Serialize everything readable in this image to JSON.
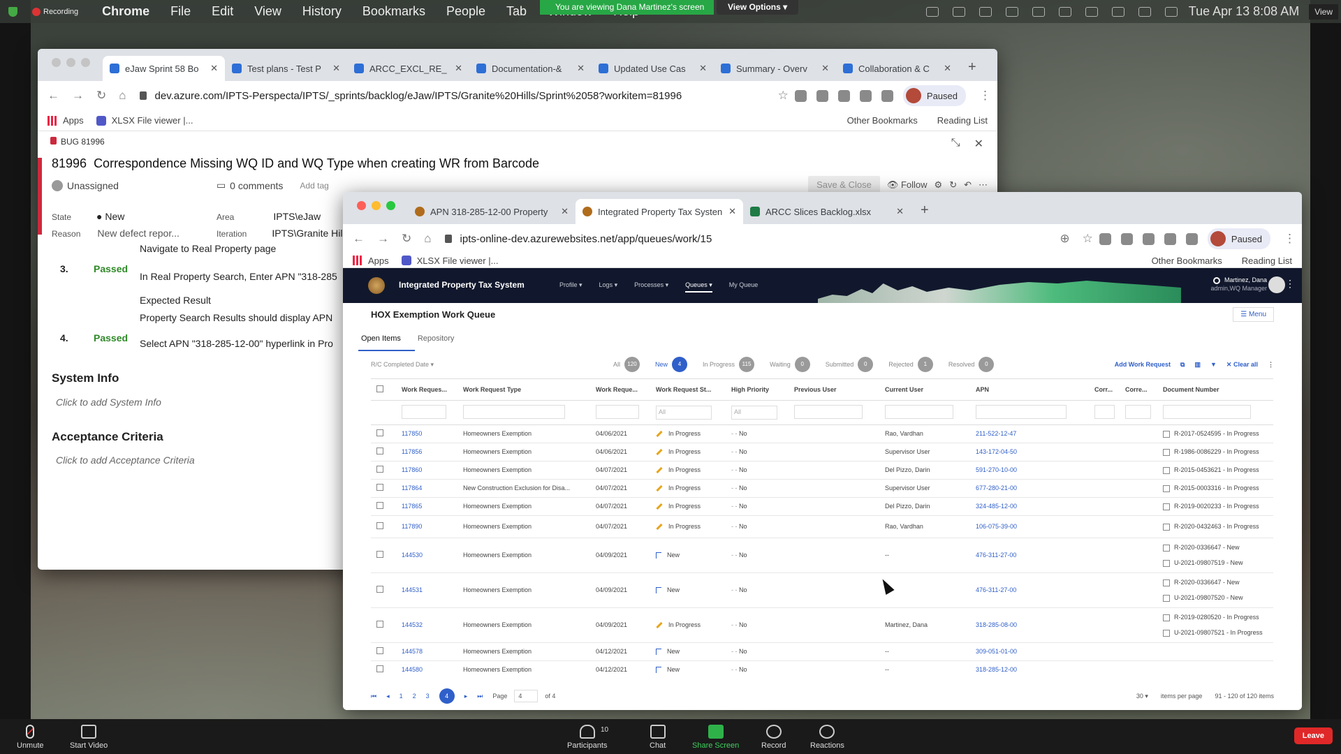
{
  "menubar": {
    "recording": "Recording",
    "items": [
      "Chrome",
      "File",
      "Edit",
      "View",
      "History",
      "Bookmarks",
      "People",
      "Tab",
      "Window",
      "Help"
    ],
    "share_banner": "You are viewing Dana Martinez's screen",
    "view_options": "View Options",
    "clock": "Tue Apr 13  8:08 AM",
    "view": "View"
  },
  "window1": {
    "tabs": [
      "eJaw Sprint 58 Bo",
      "Test plans - Test P",
      "ARCC_EXCL_RE_",
      "Documentation-&",
      "Updated Use Cas",
      "Summary - Overv",
      "Collaboration & C"
    ],
    "url": "dev.azure.com/IPTS-Perspecta/IPTS/_sprints/backlog/eJaw/IPTS/Granite%20Hills/Sprint%2058?workitem=81996",
    "bookmarks": {
      "apps": "Apps",
      "xlsx": "XLSX File viewer |...",
      "other": "Other Bookmarks",
      "reading": "Reading List"
    },
    "paused": "Paused",
    "bug_label": "BUG 81996",
    "bug_id": "81996",
    "bug_title": "Correspondence Missing WQ ID and WQ Type when creating WR from Barcode",
    "assigned": "Unassigned",
    "comments": "0 comments",
    "add_tag": "Add tag",
    "save_close": "Save & Close",
    "follow": "Follow",
    "state_label": "State",
    "state": "New",
    "reason_label": "Reason",
    "reason": "New defect repor...",
    "area_label": "Area",
    "area": "IPTS\\eJaw",
    "iteration_label": "Iteration",
    "iteration": "IPTS\\Granite Hills",
    "step_nav": "Navigate to Real Property page",
    "step3_num": "3.",
    "step3_status": "Passed",
    "step3_text": "In Real Property Search, Enter APN \"318-285",
    "expected": "Expected Result",
    "expected_text": "Property Search Results should display APN",
    "step4_num": "4.",
    "step4_status": "Passed",
    "step4_text": "Select APN \"318-285-12-00\" hyperlink in Pro",
    "system_info": "System Info",
    "system_info_ph": "Click to add System Info",
    "acceptance": "Acceptance Criteria",
    "acceptance_ph": "Click to add Acceptance Criteria"
  },
  "window2": {
    "tabs": [
      "APN 318-285-12-00 Property",
      "Integrated Property Tax Systen",
      "ARCC Slices Backlog.xlsx"
    ],
    "url": "ipts-online-dev.azurewebsites.net/app/queues/work/15",
    "paused": "Paused",
    "bookmarks": {
      "apps": "Apps",
      "xlsx": "XLSX File viewer |...",
      "other": "Other Bookmarks",
      "reading": "Reading List"
    },
    "app_name": "Integrated Property Tax System",
    "app_menu": [
      "Profile",
      "Logs",
      "Processes",
      "Queues",
      "My Queue"
    ],
    "user_name": "Martinez, Dana",
    "user_role": "admin,WQ Manager",
    "queue_title": "HOX Exemption Work Queue",
    "menu": "Menu",
    "subtabs": [
      "Open Items",
      "Repository"
    ],
    "filter_label": "R/C Completed Date",
    "chips": [
      {
        "label": "All",
        "count": "120"
      },
      {
        "label": "New",
        "count": "4"
      },
      {
        "label": "In Progress",
        "count": "115"
      },
      {
        "label": "Waiting",
        "count": "0"
      },
      {
        "label": "Submitted",
        "count": "0"
      },
      {
        "label": "Rejected",
        "count": "1"
      },
      {
        "label": "Resolved",
        "count": "0"
      }
    ],
    "add_work_request": "Add Work Request",
    "clear_all": "Clear all",
    "columns": [
      "Work Reques...",
      "Work Request Type",
      "Work Reque...",
      "Work Request St...",
      "High Priority",
      "Previous User",
      "Current User",
      "APN",
      "Corr...",
      "Corre...",
      "Document Number"
    ],
    "filter_all": "All",
    "rows": [
      {
        "id": "117850",
        "type": "Homeowners Exemption",
        "date": "04/06/2021",
        "status": "In Progress",
        "icon": "pencil",
        "hp": "No",
        "prev": "",
        "cur": "Rao, Vardhan",
        "apn": "211-522-12-47",
        "docs": [
          "R-2017-0524595 - In Progress"
        ]
      },
      {
        "id": "117856",
        "type": "Homeowners Exemption",
        "date": "04/06/2021",
        "status": "In Progress",
        "icon": "pencil",
        "hp": "No",
        "prev": "",
        "cur": "Supervisor User",
        "apn": "143-172-04-50",
        "docs": [
          "R-1986-0086229 - In Progress"
        ]
      },
      {
        "id": "117860",
        "type": "Homeowners Exemption",
        "date": "04/07/2021",
        "status": "In Progress",
        "icon": "pencil",
        "hp": "No",
        "prev": "",
        "cur": "Del Pizzo, Darin",
        "apn": "591-270-10-00",
        "docs": [
          "R-2015-0453621 - In Progress"
        ]
      },
      {
        "id": "117864",
        "type": "New Construction Exclusion for Disa...",
        "date": "04/07/2021",
        "status": "In Progress",
        "icon": "pencil",
        "hp": "No",
        "prev": "",
        "cur": "Supervisor User",
        "apn": "677-280-21-00",
        "docs": [
          "R-2015-0003316 - In Progress"
        ]
      },
      {
        "id": "117865",
        "type": "Homeowners Exemption",
        "date": "04/07/2021",
        "status": "In Progress",
        "icon": "pencil",
        "hp": "No",
        "prev": "",
        "cur": "Del Pizzo, Darin",
        "apn": "324-485-12-00",
        "docs": [
          "R-2019-0020233 - In Progress"
        ]
      },
      {
        "id": "117890",
        "type": "Homeowners Exemption",
        "date": "04/07/2021",
        "status": "In Progress",
        "icon": "pencil",
        "hp": "No",
        "prev": "",
        "cur": "Rao, Vardhan",
        "apn": "106-075-39-00",
        "docs": [
          "R-2020-0432463 - In Progress"
        ]
      },
      {
        "id": "144530",
        "type": "Homeowners Exemption",
        "date": "04/09/2021",
        "status": "New",
        "icon": "flag",
        "hp": "No",
        "prev": "",
        "cur": "--",
        "apn": "476-311-27-00",
        "docs": [
          "R-2020-0336647 - New",
          "U-2021-09807519 - New"
        ]
      },
      {
        "id": "144531",
        "type": "Homeowners Exemption",
        "date": "04/09/2021",
        "status": "New",
        "icon": "flag",
        "hp": "No",
        "prev": "",
        "cur": "--",
        "apn": "476-311-27-00",
        "docs": [
          "R-2020-0336647 - New",
          "U-2021-09807520 - New"
        ]
      },
      {
        "id": "144532",
        "type": "Homeowners Exemption",
        "date": "04/09/2021",
        "status": "In Progress",
        "icon": "pencil",
        "hp": "No",
        "prev": "",
        "cur": "Martinez, Dana",
        "apn": "318-285-08-00",
        "docs": [
          "R-2019-0280520 - In Progress",
          "U-2021-09807521 - In Progress"
        ]
      },
      {
        "id": "144578",
        "type": "Homeowners Exemption",
        "date": "04/12/2021",
        "status": "New",
        "icon": "flag",
        "hp": "No",
        "prev": "",
        "cur": "--",
        "apn": "309-051-01-00",
        "docs": []
      },
      {
        "id": "144580",
        "type": "Homeowners Exemption",
        "date": "04/12/2021",
        "status": "New",
        "icon": "flag",
        "hp": "No",
        "prev": "",
        "cur": "--",
        "apn": "318-285-12-00",
        "docs": []
      }
    ],
    "pager": {
      "pages": [
        "1",
        "2",
        "3",
        "4"
      ],
      "current": "4",
      "page_label": "Page",
      "page_value": "4",
      "of": "of 4",
      "per_page": "30",
      "per_page_label": "items per page",
      "range": "91 - 120 of 120 items"
    }
  },
  "zoom": {
    "unmute": "Unmute",
    "start_video": "Start Video",
    "participants": "Participants",
    "participant_count": "10",
    "chat": "Chat",
    "share": "Share Screen",
    "record": "Record",
    "reactions": "Reactions",
    "leave": "Leave"
  }
}
